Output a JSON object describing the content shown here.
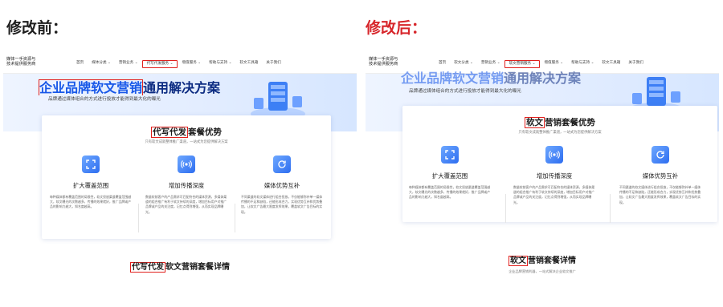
{
  "before_label": "修改前：",
  "after_label": "修改后：",
  "before": {
    "logo_line1": "媒体一手资源与",
    "logo_line2": "技术提供服务商",
    "menu": [
      "首页",
      "媒体分类 ⌄",
      "营销业务 ⌄",
      "代写代发服务 ⌄",
      "增值服务 ⌄",
      "帮助与支持 ⌄",
      "软文工具箱",
      "关于我们"
    ],
    "hero_title_marked": "企业品牌软文营销",
    "hero_title_rest": "通用解决方案",
    "hero_sub": "品牌通过媒体组合的方式进行投放才能得到最大化的曝光",
    "card_title_marked": "代写代发",
    "card_title_rest": "套餐优势",
    "card_sub": "只有软文成就整体推广渠道，一站式为您提供解决方案",
    "features": [
      {
        "name": "扩大覆盖范围",
        "desc": "每种媒体都有覆盖范围的局限性，软文投放渠道覆盖范围越大，软文曝光的次数越多，传播的效果就好，推广品牌或产品的影响力越大，知名度越高。"
      },
      {
        "name": "增加传播深度",
        "desc": "数量较前客户的产品需求可匹配符合的媒体资源，多媒体渠道的组合推广有利于软文持续的深度，增加目标用户对推广品牌或产品的关注度，记忆点得到增强，从而实现品牌曝光。"
      },
      {
        "name": "媒体优势互补",
        "desc": "不同渠道的软文媒体进行组合投放，不仅能够弥补单一媒体传播的不足和缺陷，还能形成合力，实现优势互补和优势叠加，让软文广告最大限度发挥效果，覆盖软文广告目标的实现。"
      }
    ],
    "section2_marked": "代写代发",
    "section2_rest": "软文营销套餐详情",
    "section2_sub": ""
  },
  "after": {
    "logo_line1": "媒体一手资源与",
    "logo_line2": "技术提供服务商",
    "menu": [
      "首页",
      "软文分类 ⌄",
      "营销业务 ⌄",
      "软文营销服务 ⌄",
      "增值服务 ⌄",
      "帮助与支持 ⌄",
      "软文工具箱",
      "关于我们"
    ],
    "hero_title_marked": "企业品牌软文营销",
    "hero_title_rest": "通用解决方案",
    "hero_sub": "品牌通过媒体组合的方式进行投放才能得到最大化的曝光",
    "card_title_marked": "软文",
    "card_title_rest": "营销套餐优势",
    "card_sub": "只有软文成就整体推广渠道，一站式为您提供解决方案",
    "features": [
      {
        "name": "扩大覆盖范围",
        "desc": "每种媒体都有覆盖范围的局限性，软文投放渠道覆盖范围越大，软文曝光的次数越多，传播的效果就好，推广品牌或产品的影响力越大，知名度越高。"
      },
      {
        "name": "增加传播深度",
        "desc": "数量较前客户的产品需求可匹配符合的媒体资源，多媒体渠道的组合推广有利于软文持续的深度，增加目标用户对推广品牌或产品的关注度，记忆点得到增强，从而实现品牌曝光。"
      },
      {
        "name": "媒体优势互补",
        "desc": "不同渠道的软文媒体进行组合投放，不仅能够弥补单一媒体传播的不足和缺陷，还能形成合力，实现优势互补和优势叠加，让软文广告最大限度发挥效果，覆盖软文广告目标的实现。"
      }
    ],
    "section2_marked": "软文",
    "section2_rest": "营销套餐详情",
    "section2_sub": "企业品牌营销利器，一站式解决企业软文推广"
  },
  "colors": {
    "accent_blue": "#1757e8",
    "highlight_red": "#e0201d",
    "after_label": "#d7262b"
  },
  "icons": [
    "expand-icon",
    "broadcast-icon",
    "refresh-icon"
  ]
}
